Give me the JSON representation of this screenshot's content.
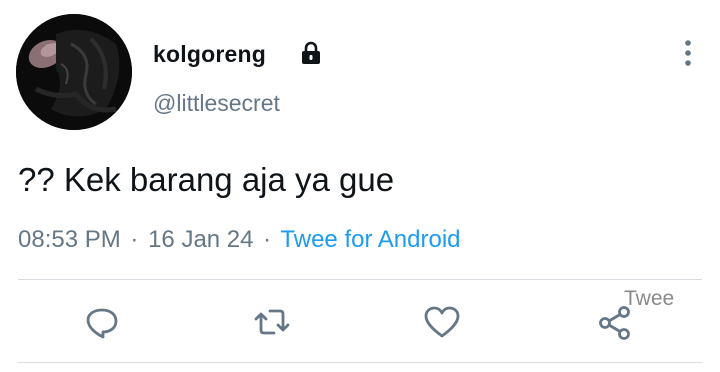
{
  "user": {
    "display_name": "kolgoreng",
    "handle": "@littlesecret",
    "avatar_icon": "avatar-image",
    "protected_icon": "lock-icon"
  },
  "tweet": {
    "text": "?? Kek barang aja ya gue",
    "time": "08:53 PM",
    "date": "16 Jan 24",
    "separator": "·",
    "source": "Twee for Android"
  },
  "actions": [
    {
      "icon": "reply-icon"
    },
    {
      "icon": "retweet-icon"
    },
    {
      "icon": "like-icon"
    },
    {
      "icon": "share-icon"
    }
  ],
  "watermark": "Twee",
  "colors": {
    "text": "#0f1419",
    "secondary": "#657786",
    "link": "#1d9bf0",
    "icon": "#657786"
  }
}
